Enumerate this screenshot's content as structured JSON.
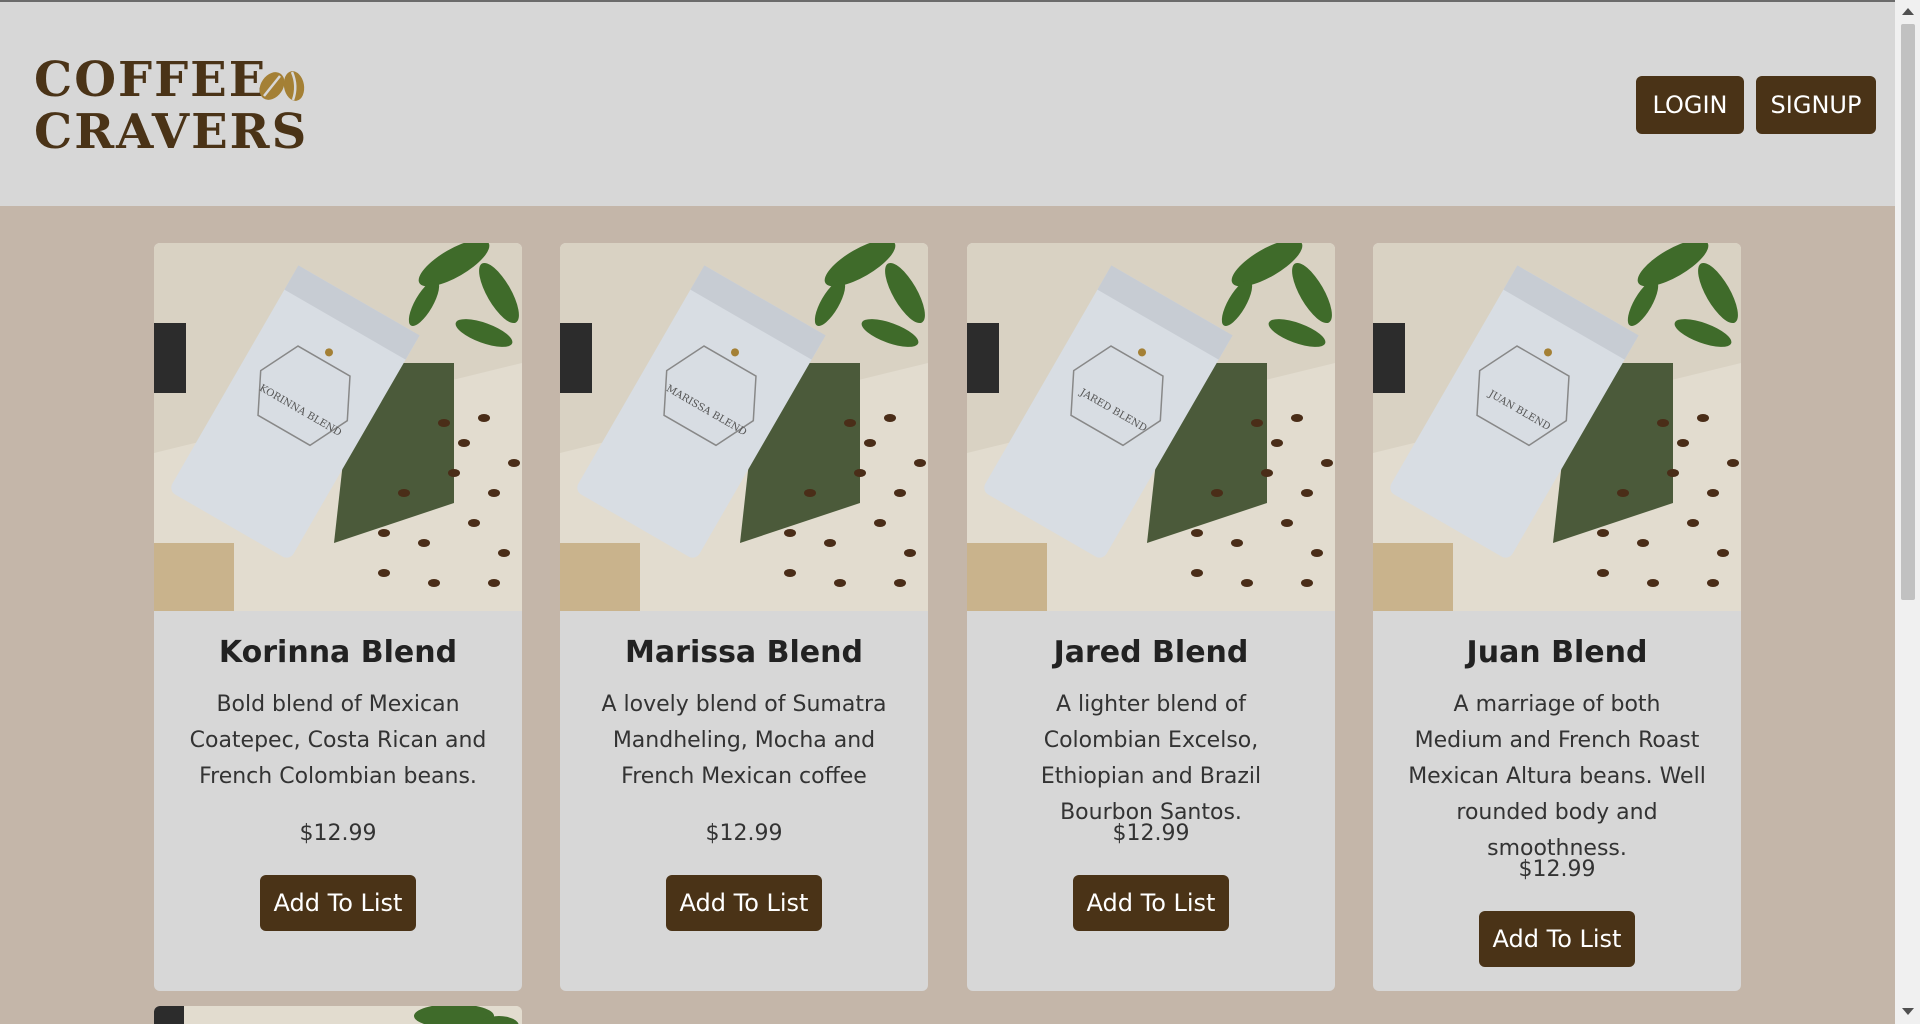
{
  "brand": {
    "line1": "COFFEE",
    "line2": "CRAVERS",
    "color": "#4a3317",
    "accent": "#a48035"
  },
  "nav": {
    "login_label": "LOGIN",
    "signup_label": "SIGNUP"
  },
  "products": [
    {
      "name": "Korinna Blend",
      "bag_label": "KORINNA BLEND",
      "description": "Bold blend of Mexican Coatepec, Costa Rican and French Colombian beans.",
      "price": "$12.99",
      "button_label": "Add To List"
    },
    {
      "name": "Marissa Blend",
      "bag_label": "MARISSA BLEND",
      "description": "A lovely blend of Sumatra Mandheling, Mocha and French Mexican coffee",
      "price": "$12.99",
      "button_label": "Add To List"
    },
    {
      "name": "Jared Blend",
      "bag_label": "JARED BLEND",
      "description": "A lighter blend of Colombian Excelso, Ethiopian and Brazil Bourbon Santos.",
      "price": "$12.99",
      "button_label": "Add To List"
    },
    {
      "name": "Juan Blend",
      "bag_label": "JUAN BLEND",
      "description": "A marriage of both Medium and French Roast Mexican Altura beans. Well rounded body and smoothness.",
      "price": "$12.99",
      "button_label": "Add To List"
    }
  ],
  "colors": {
    "header_bg": "#d7d7d7",
    "page_bg": "#c4b6a9",
    "card_bg": "#d7d7d7",
    "button_bg": "#4a3317"
  }
}
